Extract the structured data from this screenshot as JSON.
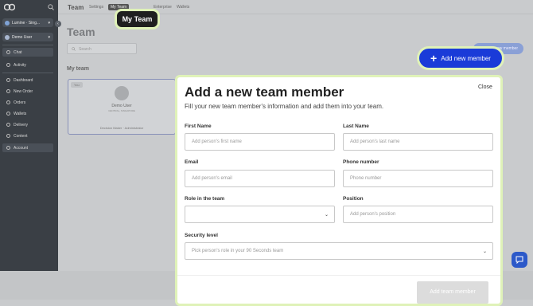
{
  "sidebar": {
    "workspace": "Lumine · Sing...",
    "user": "Demo User",
    "items": [
      {
        "label": "Chat",
        "icon": "chat-icon"
      },
      {
        "label": "Activity",
        "icon": "activity-icon"
      },
      {
        "label": "Dashboard",
        "icon": "dashboard-icon"
      },
      {
        "label": "New Order",
        "icon": "new-order-icon"
      },
      {
        "label": "Orders",
        "icon": "orders-icon"
      },
      {
        "label": "Wallets",
        "icon": "wallets-icon"
      },
      {
        "label": "Delivery",
        "icon": "delivery-icon"
      },
      {
        "label": "Content",
        "icon": "content-icon"
      },
      {
        "label": "Account",
        "icon": "account-icon"
      }
    ]
  },
  "topbar": {
    "title": "Team",
    "tabs": [
      "Settings",
      "My Team",
      "Enterprise",
      "Wallets"
    ]
  },
  "page": {
    "title": "Team",
    "search_placeholder": "Search",
    "add_member_bg": "Add new member",
    "section_label": "My team"
  },
  "member_card": {
    "tag": "You",
    "name": "Demo User",
    "location": "CENTRAL, SINGAPORE",
    "role": "Decision Maker · Administrator"
  },
  "callouts": {
    "my_team": "My Team",
    "add_new_member": "Add new member"
  },
  "modal": {
    "title": "Add a new team member",
    "close": "Close",
    "subtitle": "Fill your new team member's information and add them into your team.",
    "first_name_label": "First Name",
    "first_name_placeholder": "Add person's first name",
    "last_name_label": "Last Name",
    "last_name_placeholder": "Add person's last name",
    "email_label": "Email",
    "email_placeholder": "Add person's email",
    "phone_label": "Phone number",
    "phone_placeholder": "Phone number",
    "role_label": "Role in the team",
    "role_value": "",
    "position_label": "Position",
    "position_placeholder": "Add person's position",
    "security_label": "Security level",
    "security_placeholder": "Pick person's role in your 90 Seconds team",
    "submit": "Add team member"
  },
  "colors": {
    "accent": "#1a3bd8",
    "highlight": "#dff2b8",
    "sidebar_bg": "#3a3f45"
  }
}
